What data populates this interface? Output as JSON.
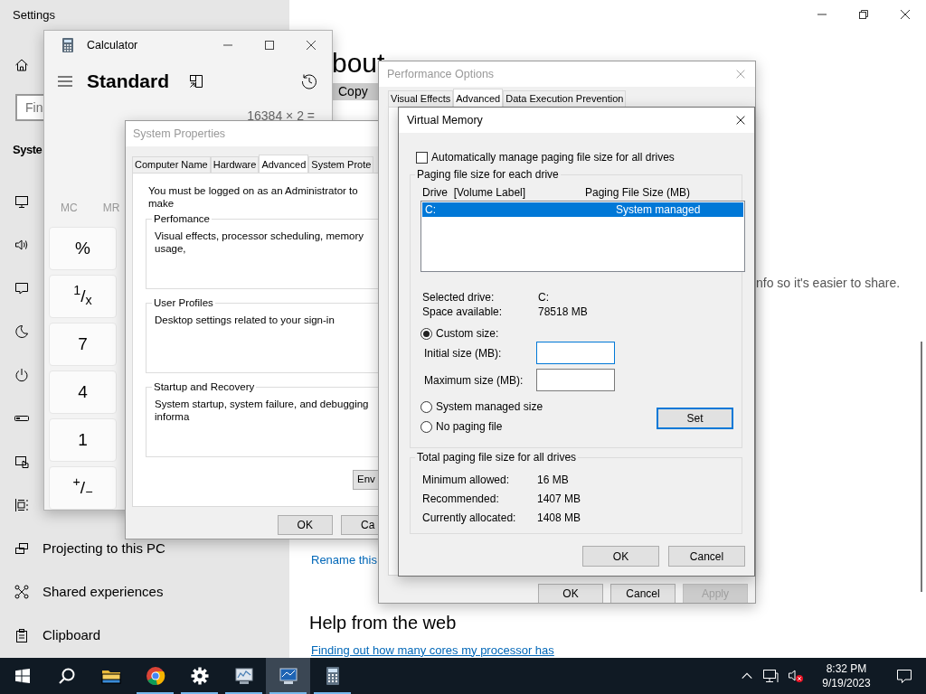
{
  "settings": {
    "title": "Settings",
    "search": {
      "placeholder": "Fin"
    },
    "section": "Syste",
    "nav_items": [
      {
        "label": "Projecting to this PC"
      },
      {
        "label": "Shared experiences"
      },
      {
        "label": "Clipboard"
      }
    ],
    "heading": "bout",
    "copy_button": "Copy",
    "info_text": "nfo so it's easier to share.",
    "rename_link": "Rename this",
    "help_heading": "Help from the web",
    "help_link": "Finding out how many cores my processor has"
  },
  "calculator": {
    "title": "Calculator",
    "mode": "Standard",
    "expression": "16384 × 2 =",
    "memory_buttons": [
      "MC",
      "MR"
    ],
    "keys": [
      "%",
      "$^{1}$/$_{x}$",
      "7",
      "4",
      "1",
      "$^{+}$/$_{−}$"
    ]
  },
  "system_properties": {
    "title": "System Properties",
    "tabs": [
      {
        "label": "Computer Name",
        "selected": false
      },
      {
        "label": "Hardware",
        "selected": false
      },
      {
        "label": "Advanced",
        "selected": true
      },
      {
        "label": "System Prote",
        "selected": false
      }
    ],
    "notice": "You must be logged on as an Administrator to make",
    "groups": [
      {
        "title": "Perfomance",
        "description": "Visual effects, processor scheduling, memory usage,"
      },
      {
        "title": "User Profiles",
        "description": "Desktop settings related to your sign-in"
      },
      {
        "title": "Startup and Recovery",
        "description": "System startup, system failure, and debugging informa"
      }
    ],
    "env_button": "Env",
    "buttons": [
      "OK",
      "Ca"
    ]
  },
  "performance_options": {
    "title": "Performance Options",
    "tabs": [
      {
        "label": "Visual Effects",
        "selected": false
      },
      {
        "label": "Advanced",
        "selected": true
      },
      {
        "label": "Data Execution Prevention",
        "selected": false
      }
    ],
    "buttons": [
      {
        "label": "OK",
        "disabled": false
      },
      {
        "label": "Cancel",
        "disabled": false
      },
      {
        "label": "Apply",
        "disabled": true
      }
    ]
  },
  "virtual_memory": {
    "title": "Virtual Memory",
    "auto_manage": {
      "label": "Automatically manage paging file size for all drives",
      "checked": false
    },
    "group_title": "Paging file size for each drive",
    "columns": [
      "Drive  [Volume Label]",
      "Paging File Size (MB)"
    ],
    "drives": [
      {
        "drive": "C:",
        "size": "System managed",
        "selected": true
      }
    ],
    "info": [
      {
        "label": "Selected drive:",
        "value": "C:"
      },
      {
        "label": "Space available:",
        "value": "78518 MB"
      }
    ],
    "options": [
      {
        "label": "Custom size:",
        "selected": true
      },
      {
        "label": "System managed size",
        "selected": false
      },
      {
        "label": "No paging file",
        "selected": false
      }
    ],
    "fields": [
      {
        "label": "Initial size (MB):",
        "focused": true
      },
      {
        "label": "Maximum size (MB):",
        "focused": false
      }
    ],
    "set_button": {
      "label": "Set",
      "default": true
    },
    "totals_title": "Total paging file size for all drives",
    "totals": [
      {
        "label": "Minimum allowed:",
        "value": "16 MB"
      },
      {
        "label": "Recommended:",
        "value": "1407 MB"
      },
      {
        "label": "Currently allocated:",
        "value": "1408 MB"
      }
    ],
    "buttons": [
      "OK",
      "Cancel"
    ]
  },
  "taskbar": {
    "apps": [
      {
        "running": false,
        "active": false
      },
      {
        "running": true,
        "active": false
      },
      {
        "running": true,
        "active": false
      },
      {
        "running": true,
        "active": false
      },
      {
        "running": true,
        "active": true
      },
      {
        "running": true,
        "active": false
      }
    ],
    "time": "8:32 PM",
    "date": "9/19/2023"
  }
}
